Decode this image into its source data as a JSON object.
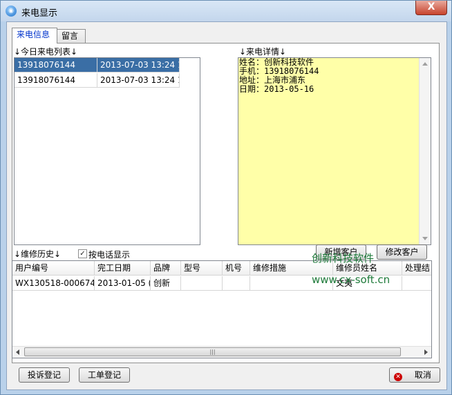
{
  "window": {
    "title": "来电显示",
    "close_label": "X"
  },
  "tabs": [
    {
      "label": "来电信息"
    },
    {
      "label": "留言"
    }
  ],
  "call_list": {
    "label": "↓今日来电列表↓",
    "rows": [
      {
        "phone": "13918076144",
        "time": "2013-07-03 13:24 1"
      },
      {
        "phone": "13918076144",
        "time": "2013-07-03 13:24 1"
      }
    ]
  },
  "call_detail": {
    "label": "↓来电详情↓",
    "lines": [
      "姓名：创新科技软件",
      "手机：13918076144",
      "地址：上海市浦东",
      "日期：2013-05-16"
    ]
  },
  "buttons": {
    "add_customer": "新增客户",
    "edit_customer": "修改客户",
    "complaint": "投诉登记",
    "work_order": "工单登记",
    "cancel": "取消"
  },
  "repair_history": {
    "label": "↓维修历史↓",
    "checkbox_label": "按电话显示",
    "checkbox_checked": true,
    "columns": [
      "用户编号",
      "完工日期",
      "品牌",
      "型号",
      "机号",
      "维修措施",
      "维修员姓名",
      "处理结"
    ],
    "rows": [
      {
        "cells": [
          "WX130518-000674",
          "2013-01-05 (",
          "创新",
          "",
          "",
          "",
          "文夷",
          ""
        ]
      }
    ]
  },
  "watermark": {
    "cn": "创新科技软件",
    "url": "www.cx-soft.cn"
  },
  "icons": {
    "title": "app-icon",
    "cancel": "cancel-icon",
    "check": "check-icon"
  }
}
